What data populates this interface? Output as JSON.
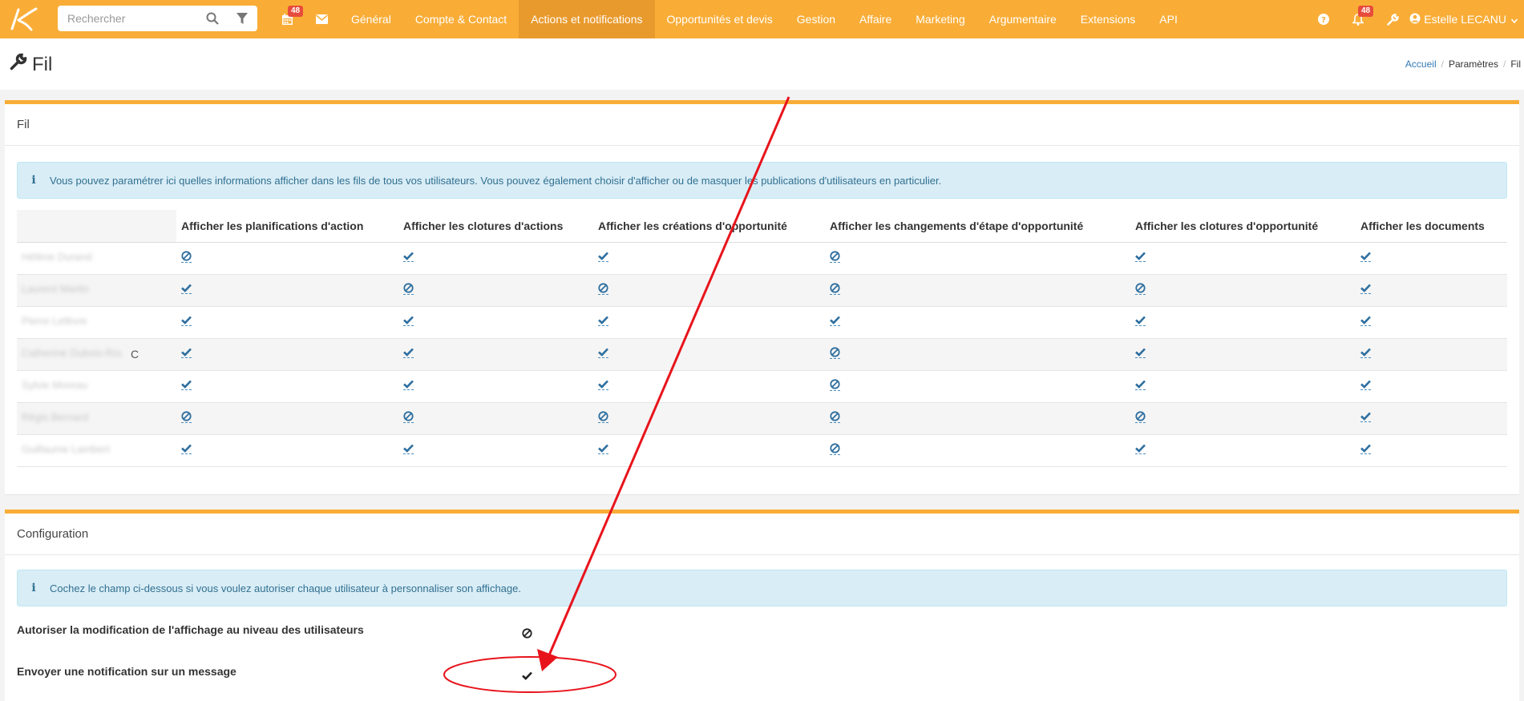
{
  "colors": {
    "brand": "#f9ad37",
    "brand_active": "#e99a2d",
    "badge": "#e74c3c",
    "info_bg": "#d9edf7",
    "mark": "#2f6f9f",
    "annotation": "#e8141c"
  },
  "topbar": {
    "search_placeholder": "Rechercher",
    "calendar_badge": "48",
    "notifications_badge": "48",
    "nav": [
      "Général",
      "Compte & Contact",
      "Actions et notifications",
      "Opportunités et devis",
      "Gestion",
      "Affaire",
      "Marketing",
      "Argumentaire",
      "Extensions",
      "API"
    ],
    "active_nav": "Actions et notifications",
    "user_name": "Estelle LECANU",
    "icons": [
      "search-icon",
      "filter-icon",
      "calendar-icon",
      "envelope-icon",
      "help-icon",
      "bell-icon",
      "wrench-icon",
      "user-globe-icon"
    ]
  },
  "page": {
    "title": "Fil",
    "breadcrumb": [
      "Accueil",
      "Paramètres",
      "Fil"
    ]
  },
  "fil_panel": {
    "title": "Fil",
    "info": "Vous pouvez paramétrer ici quelles informations afficher dans les fils de tous vos utilisateurs. Vous pouvez également choisir d'afficher ou de masquer les publications d'utilisateurs en particulier.",
    "columns": [
      "Afficher les planifications d'action",
      "Afficher les clotures d'actions",
      "Afficher les créations d'opportunité",
      "Afficher les changements d'étape d'opportunité",
      "Afficher les clotures d'opportunité",
      "Afficher les documents"
    ],
    "rows": [
      {
        "user": "Hélène Durand",
        "suffix": "",
        "values": [
          false,
          true,
          true,
          false,
          true,
          true
        ]
      },
      {
        "user": "Laurent Martin",
        "suffix": "",
        "values": [
          true,
          false,
          false,
          false,
          false,
          true
        ]
      },
      {
        "user": "Pierre Lefèvre",
        "suffix": "",
        "values": [
          true,
          true,
          true,
          true,
          true,
          true
        ]
      },
      {
        "user": "Catherine Dubois-Roux",
        "suffix": "C",
        "values": [
          true,
          true,
          true,
          false,
          true,
          true
        ]
      },
      {
        "user": "Sylvie Moreau",
        "suffix": "",
        "values": [
          true,
          true,
          true,
          false,
          true,
          true
        ]
      },
      {
        "user": "Régis Bernard",
        "suffix": "",
        "values": [
          false,
          false,
          false,
          false,
          false,
          true
        ]
      },
      {
        "user": "Guillaume Lambert",
        "suffix": "",
        "values": [
          true,
          true,
          true,
          false,
          true,
          true
        ]
      }
    ]
  },
  "config_panel": {
    "title": "Configuration",
    "info": "Cochez le champ ci-dessous si vous voulez autoriser chaque utilisateur à personnaliser son affichage.",
    "settings": [
      {
        "label": "Autoriser la modification de l'affichage au niveau des utilisateurs",
        "enabled": false
      },
      {
        "label": "Envoyer une notification sur un message",
        "enabled": true
      }
    ]
  }
}
